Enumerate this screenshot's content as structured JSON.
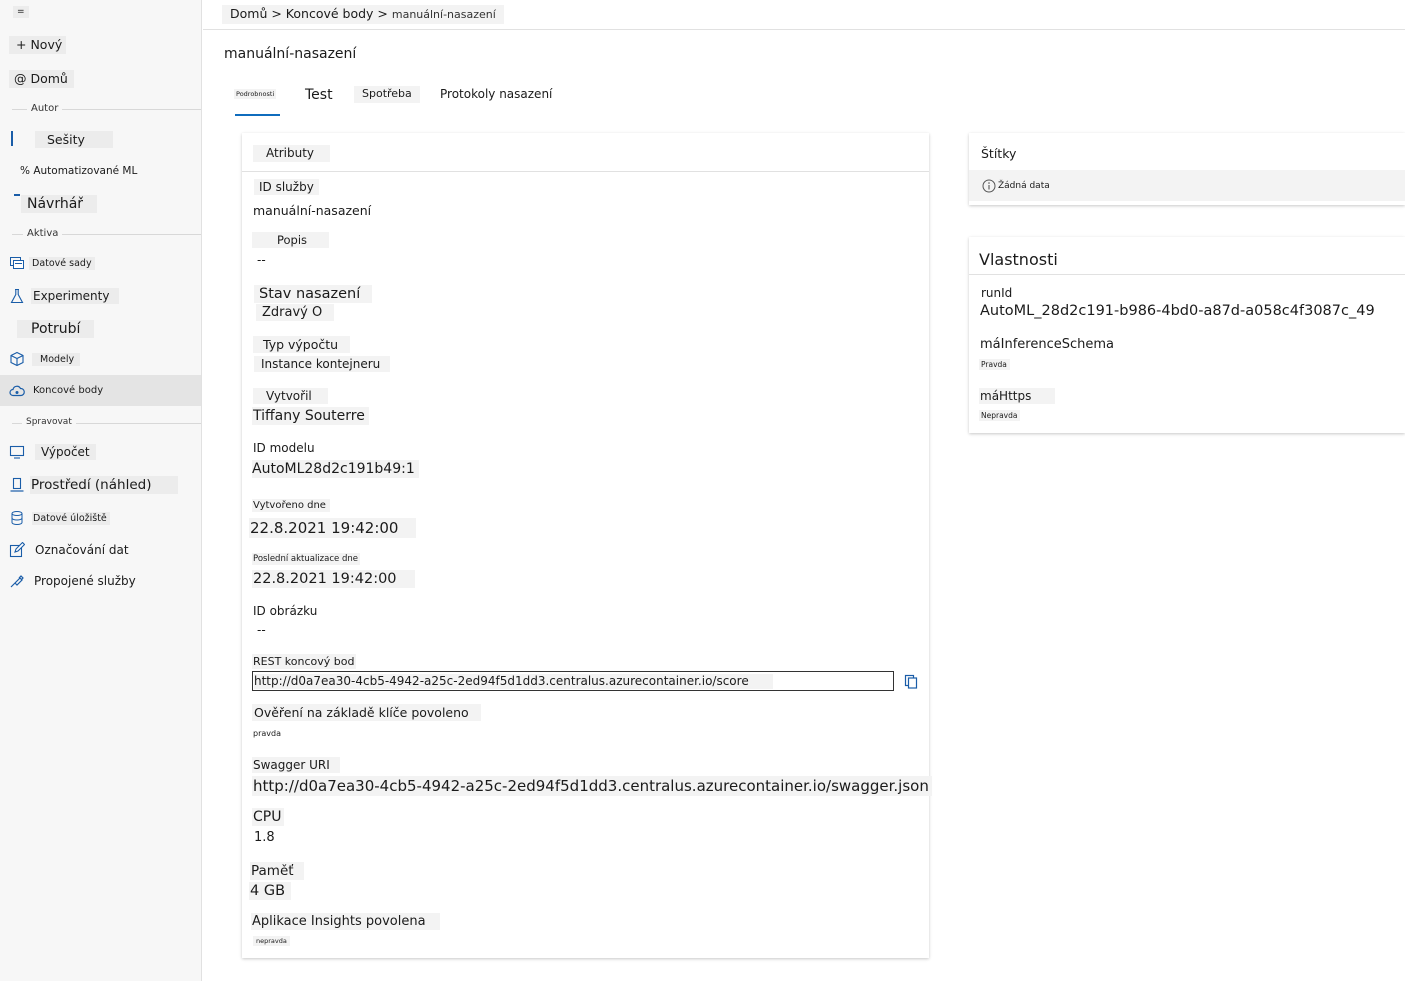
{
  "sidebar": {
    "menu_glyph": "=",
    "new_label": "+ Nový",
    "home_label": "@ Domů",
    "sections": {
      "author": "Autor",
      "assets": "Aktiva",
      "manage": "Spravovat"
    },
    "items": {
      "notebooks": "Sešity",
      "automl": "% Automatizované ML",
      "designer": "Návrhář",
      "datasets": "Datové sady",
      "experiments": "Experimenty",
      "pipelines": "Potrubí",
      "models": "Modely",
      "endpoints": "Koncové body",
      "compute": "Výpočet",
      "environments": "Prostředí (náhled)",
      "datastores": "Datové úložiště",
      "labeling": "Označování dat",
      "linked": "Propojené služby"
    }
  },
  "breadcrumb": {
    "home": "Domů",
    "sep1": " > ",
    "endpoints": "Koncové body",
    "sep2": " > ",
    "current": "manuální-nasazení"
  },
  "page_title": "manuální-nasazení",
  "tabs": {
    "details": "Podrobnosti",
    "test": "Test",
    "consume": "Spotřeba",
    "logs": "Protokoly nasazení"
  },
  "attributes": {
    "title": "Atributy",
    "service_id_label": "ID služby",
    "service_id_value": "manuální-nasazení",
    "description_label": "Popis",
    "description_value": "--",
    "state_label": "Stav nasazení",
    "state_value": "Zdravý O",
    "compute_type_label": "Typ výpočtu",
    "compute_type_value": "Instance kontejneru",
    "created_by_label": "Vytvořil",
    "created_by_value": "Tiffany Souterre",
    "model_id_label": "ID modelu",
    "model_id_value": "AutoML28d2c191b49:1",
    "created_on_label": "Vytvořeno dne",
    "created_on_value": "22.8.2021 19:42:00",
    "updated_on_label": "Poslední aktualizace dne",
    "updated_on_value": "22.8.2021 19:42:00",
    "image_id_label": "ID obrázku",
    "image_id_value": "--",
    "rest_label": "REST koncový bod",
    "rest_value": "http://d0a7ea30-4cb5-4942-a25c-2ed94f5d1dd3.centralus.azurecontainer.io/score",
    "key_auth_label": "Ověření na základě klíče povoleno",
    "key_auth_value": "pravda",
    "swagger_label": "Swagger URI",
    "swagger_value": "http://d0a7ea30-4cb5-4942-a25c-2ed94f5d1dd3.centralus.azurecontainer.io/swagger.json",
    "cpu_label": "CPU",
    "cpu_value": "1.8",
    "memory_label": "Paměť",
    "memory_value": "4 GB",
    "insights_label": "Aplikace Insights povolena",
    "insights_value": "nepravda"
  },
  "tags": {
    "title": "Štítky",
    "empty": "Žádná data"
  },
  "properties": {
    "title": "Vlastnosti",
    "runid_label": "runId",
    "runid_value": "AutoML_28d2c191-b986-4bd0-a87d-a058c4f3087c_49",
    "schema_label": "máInferenceSchema",
    "schema_value": "Pravda",
    "https_label": "máHttps",
    "https_value": "Nepravda"
  },
  "colors": {
    "accent": "#0f6cbd",
    "icon": "#1a5da8"
  }
}
